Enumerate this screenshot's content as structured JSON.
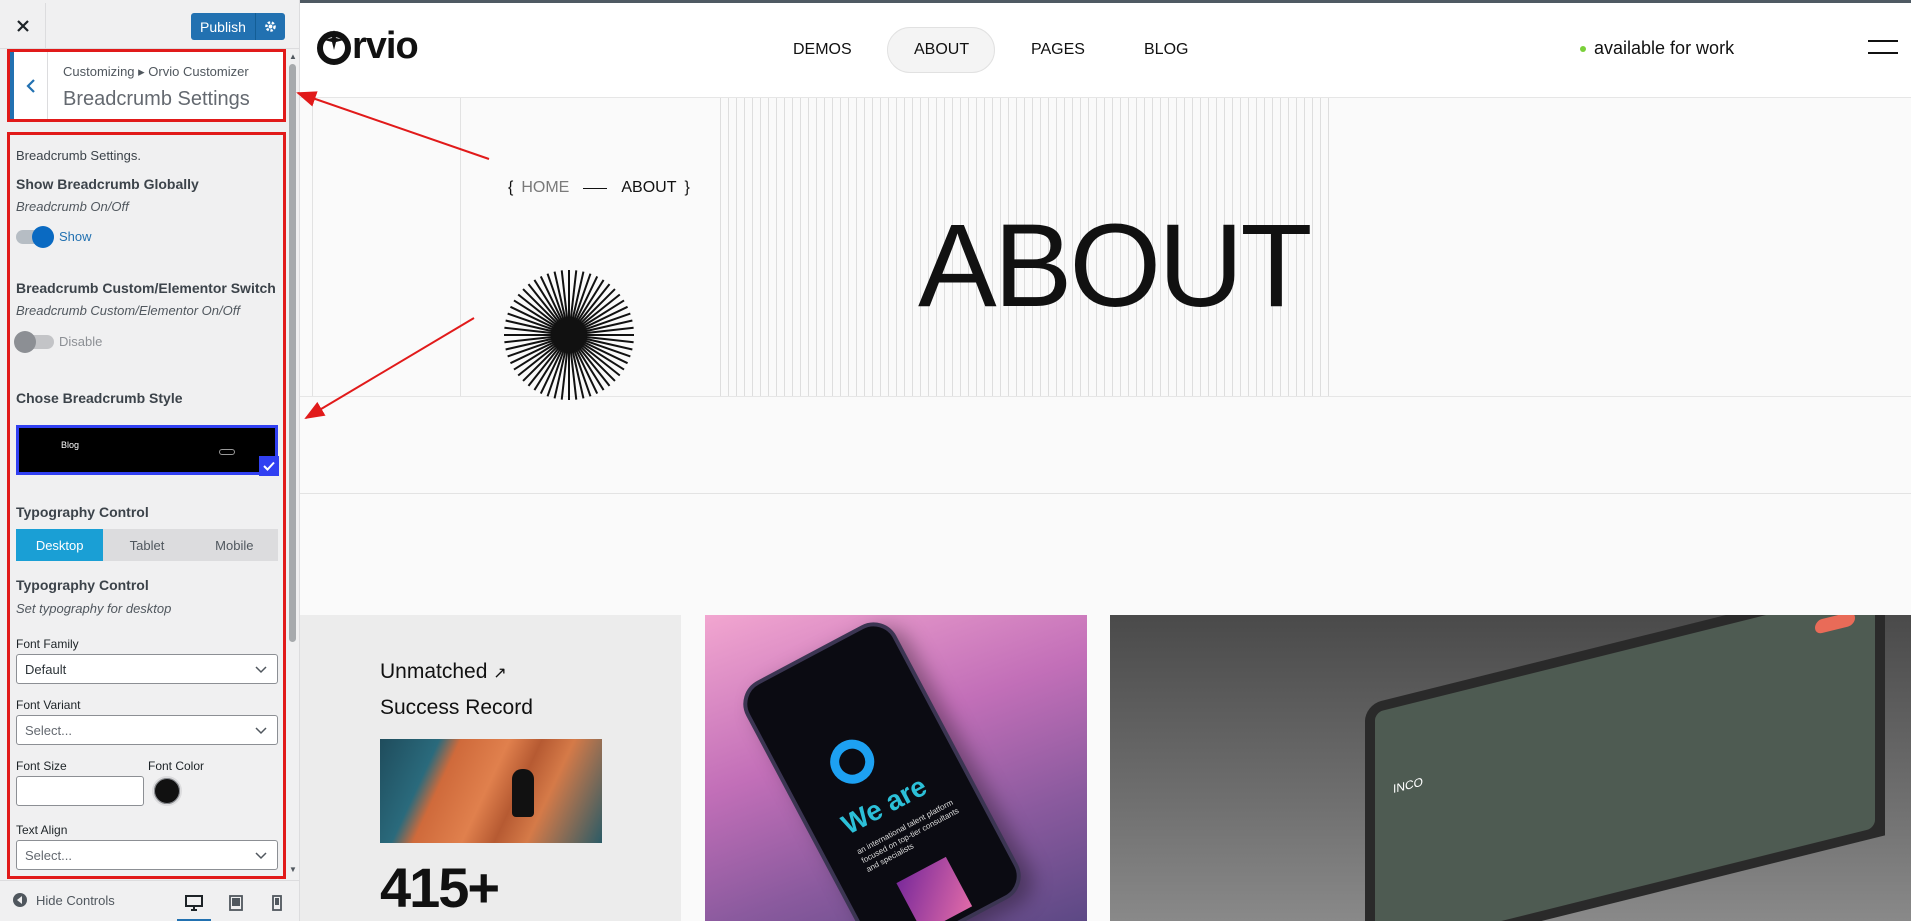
{
  "sidebar": {
    "publish_label": "Publish",
    "breadcrumb_path": "Customizing ▸ Orvio Customizer",
    "section_title": "Breadcrumb Settings",
    "section_desc": "Breadcrumb Settings.",
    "show_global": {
      "title": "Show Breadcrumb Globally",
      "desc": "Breadcrumb On/Off",
      "toggle_label": "Show",
      "enabled": true
    },
    "custom_switch": {
      "title": "Breadcrumb Custom/Elementor Switch",
      "desc": "Breadcrumb Custom/Elementor On/Off",
      "toggle_label": "Disable",
      "enabled": false
    },
    "style": {
      "title": "Chose Breadcrumb Style",
      "thumb_text": "Blog"
    },
    "typography_tabs": {
      "title": "Typography Control",
      "tabs": [
        "Desktop",
        "Tablet",
        "Mobile"
      ],
      "active": "Desktop"
    },
    "typography": {
      "title": "Typography Control",
      "desc": "Set typography for desktop",
      "font_family_label": "Font Family",
      "font_family_value": "Default",
      "font_variant_label": "Font Variant",
      "font_variant_placeholder": "Select...",
      "font_size_label": "Font Size",
      "font_size_value": "",
      "font_color_label": "Font Color",
      "font_color": "#111111",
      "text_align_label": "Text Align",
      "text_align_placeholder": "Select..."
    },
    "footer": {
      "hide_controls_label": "Hide Controls",
      "devices": [
        "desktop",
        "tablet",
        "mobile"
      ],
      "active_device": "desktop"
    }
  },
  "preview": {
    "logo": "rvio",
    "nav": [
      "DEMOS",
      "ABOUT",
      "PAGES",
      "BLOG"
    ],
    "active_nav": "ABOUT",
    "availability": "available for work",
    "breadcrumb_home": "HOME",
    "breadcrumb_current": "ABOUT",
    "hero_title": "ABOUT",
    "card1_line1": "Unmatched",
    "card1_line2": "Success Record",
    "card1_stat": "415+",
    "phone_headline": "We are",
    "phone_text": "an international talent platform focused on top-tier consultants and specialists",
    "laptop_brand": "INCO"
  },
  "colors": {
    "annotation": "#e11a1a",
    "wp_blue": "#2271b1",
    "tab_active": "#1a9fd5",
    "available_dot": "#7ad03a"
  }
}
